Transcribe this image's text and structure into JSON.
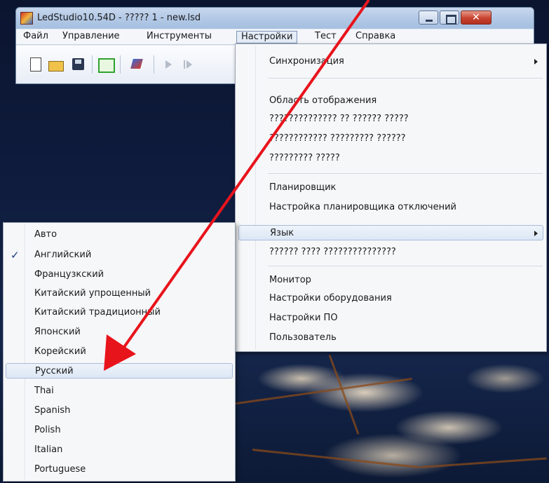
{
  "window": {
    "title": "LedStudio10.54D - ????? 1 - new.lsd",
    "close_label": "✕"
  },
  "menubar": {
    "items": [
      "Файл",
      "Управление",
      "Инструменты",
      "Настройки",
      "Тест",
      "Справка"
    ],
    "active": "Настройки"
  },
  "toolbar": {
    "icons": [
      "new-file-icon",
      "open-folder-icon",
      "save-icon",
      "led-screen-icon",
      "edit-tool-icon",
      "play-icon",
      "step-icon"
    ]
  },
  "settings_menu": {
    "items": [
      "Синхронизация",
      "Область отображения",
      "?????????????? ?? ?????? ?????",
      "???????????? ????????? ??????",
      "????????? ?????",
      "Планировщик",
      "Настройка планировщика отключений",
      "Язык",
      "?????? ???? ???????????????",
      "Монитор",
      "Настройки оборудования",
      "Настройки ПО",
      "Пользователь"
    ],
    "highlighted": "Язык"
  },
  "language_menu": {
    "items": [
      "Авто",
      "Английский",
      "Французкский",
      "Китайский упрощенный",
      "Китайский традиционный",
      "Японский",
      "Корейский",
      "Русский",
      "Thai",
      "Spanish",
      "Polish",
      "Italian",
      "Portuguese"
    ],
    "checked": "Английский",
    "highlighted": "Русский"
  },
  "colors": {
    "annotation_arrow": "#e8141c",
    "highlight_border": "#a9bcd8",
    "desktop_background": "#0f1c3e"
  }
}
